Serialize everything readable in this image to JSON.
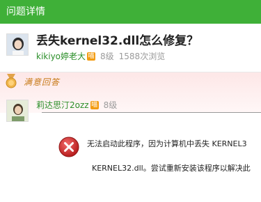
{
  "topbar": {
    "title": "问题详情"
  },
  "question": {
    "title": "丢失kernel32.dll怎么修复？",
    "asker": "kikiyo婷老大",
    "vip": "喵",
    "level": "8级",
    "views": "1588次浏览"
  },
  "answer": {
    "banner_label": "满意回答",
    "answerer": "莉达思汀2ozz",
    "vip": "喵",
    "level": "8级"
  },
  "error_dialog": {
    "line1": "无法启动此程序，因为计算机中丢失 KERNEL3",
    "line2": "KERNEL32.dll。尝试重新安装该程序以解决此"
  },
  "colors": {
    "topbar": "#3fb038",
    "username": "#2c8f2a",
    "error": "#d32f2f"
  }
}
